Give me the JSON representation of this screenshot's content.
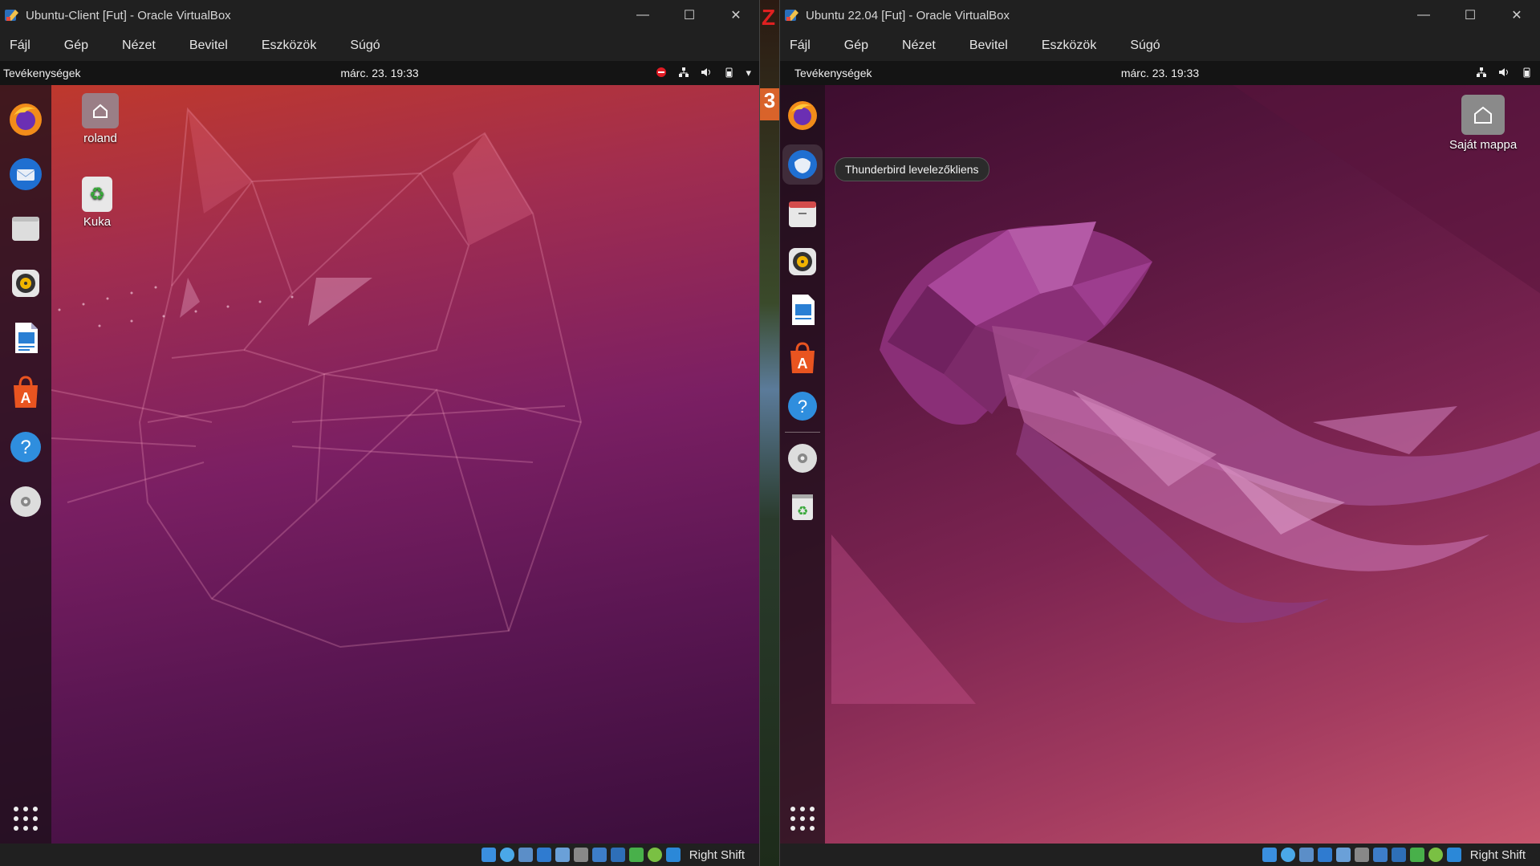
{
  "left_window": {
    "title": "Ubuntu-Client [Fut] - Oracle VirtualBox",
    "menu": [
      "Fájl",
      "Gép",
      "Nézet",
      "Bevitel",
      "Eszközök",
      "Súgó"
    ],
    "topbar": {
      "activities": "Tevékenységek",
      "clock": "márc. 23.  19:33"
    },
    "desktop_icons": [
      {
        "label": "roland",
        "icon": "home-folder-icon"
      },
      {
        "label": "Kuka",
        "icon": "trash-icon"
      }
    ],
    "dock": [
      "firefox-icon",
      "thunderbird-icon",
      "files-icon",
      "rhythmbox-icon",
      "writer-icon",
      "software-center-icon",
      "help-icon",
      "dvd-icon"
    ],
    "statusbar": {
      "host_key": "Right Shift"
    }
  },
  "right_window": {
    "title": "Ubuntu 22.04 [Fut] - Oracle VirtualBox",
    "menu": [
      "Fájl",
      "Gép",
      "Nézet",
      "Bevitel",
      "Eszközök",
      "Súgó"
    ],
    "topbar": {
      "activities": "Tevékenységek",
      "clock": "márc. 23.  19:33"
    },
    "desktop_icons": [
      {
        "label": "Saját mappa",
        "icon": "home-folder-icon"
      }
    ],
    "tooltip": "Thunderbird levelezőkliens",
    "dock": [
      "firefox-icon",
      "thunderbird-icon",
      "files-icon",
      "rhythmbox-icon",
      "writer-icon",
      "software-center-icon",
      "help-icon",
      "dvd-icon",
      "trash-icon"
    ],
    "statusbar": {
      "host_key": "Right Shift"
    }
  },
  "colors": {
    "ubuntu_orange": "#e95420",
    "aubergine": "#5a1652",
    "chrome": "#202020"
  }
}
